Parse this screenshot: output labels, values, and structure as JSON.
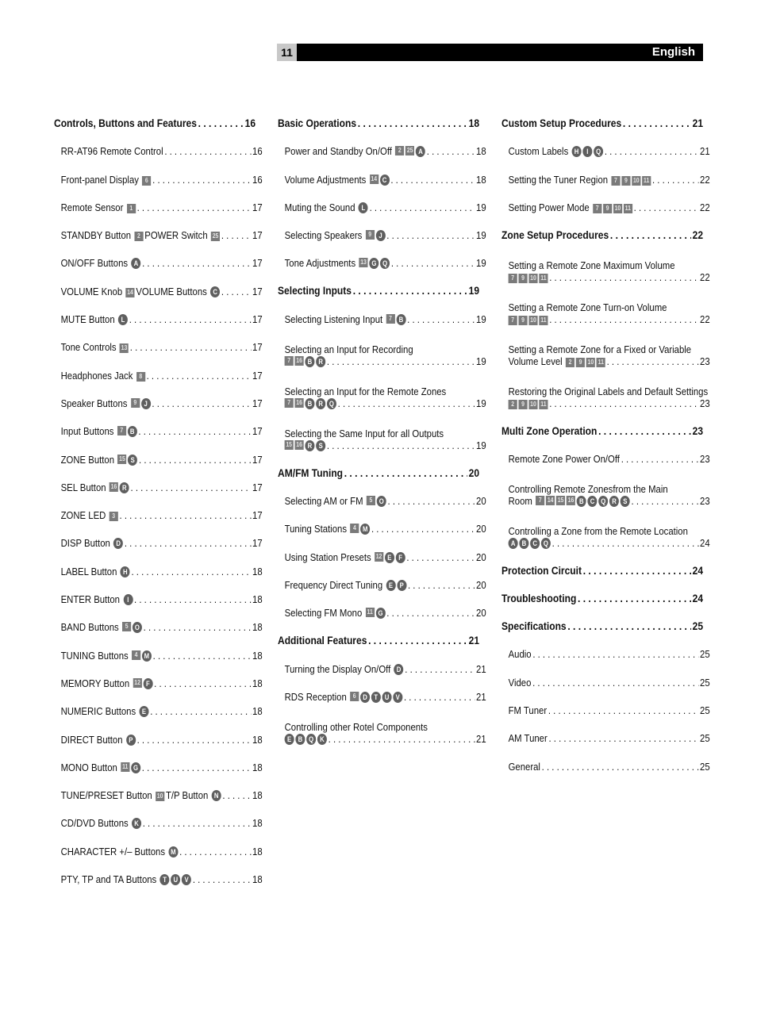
{
  "header": {
    "page_number": "11",
    "language": "English"
  },
  "columns": [
    [
      {
        "type": "section",
        "title": "Controls, Buttons and Features",
        "page": "16",
        "badges": []
      },
      {
        "type": "sub",
        "title": "RR-AT96 Remote Control",
        "page": "16",
        "badges": []
      },
      {
        "type": "sub",
        "title": "Front-panel Display",
        "page": "16",
        "badges": [
          {
            "k": "sq",
            "v": "6"
          }
        ]
      },
      {
        "type": "sub",
        "title": "Remote Sensor",
        "page": "17",
        "badges": [
          {
            "k": "sq",
            "v": "1"
          }
        ]
      },
      {
        "type": "sub",
        "title": "STANDBY Button",
        "page": "17",
        "badges": [
          {
            "k": "sq",
            "v": "2"
          }
        ],
        "title2": "POWER Switch",
        "badges2": [
          {
            "k": "sq",
            "v": "25"
          }
        ]
      },
      {
        "type": "sub",
        "title": "ON/OFF Buttons",
        "page": "17",
        "badges": [
          {
            "k": "ci",
            "v": "A"
          }
        ]
      },
      {
        "type": "sub",
        "title": "VOLUME Knob",
        "page": "17",
        "badges": [
          {
            "k": "sq",
            "v": "14"
          }
        ],
        "title2": "VOLUME Buttons",
        "badges2": [
          {
            "k": "ci",
            "v": "C"
          }
        ]
      },
      {
        "type": "sub",
        "title": "MUTE Button",
        "page": "17",
        "badges": [
          {
            "k": "ci",
            "v": "L"
          }
        ]
      },
      {
        "type": "sub",
        "title": "Tone Controls",
        "page": "17",
        "badges": [
          {
            "k": "sq",
            "v": "13"
          }
        ]
      },
      {
        "type": "sub",
        "title": "Headphones Jack",
        "page": "17",
        "badges": [
          {
            "k": "sq",
            "v": "8"
          }
        ]
      },
      {
        "type": "sub",
        "title": "Speaker Buttons",
        "page": "17",
        "badges": [
          {
            "k": "sq",
            "v": "9"
          },
          {
            "k": "ci",
            "v": "J"
          }
        ]
      },
      {
        "type": "sub",
        "title": "Input Buttons",
        "page": "17",
        "badges": [
          {
            "k": "sq",
            "v": "7"
          },
          {
            "k": "ci",
            "v": "B"
          }
        ]
      },
      {
        "type": "sub",
        "title": "ZONE Button",
        "page": "17",
        "badges": [
          {
            "k": "sq",
            "v": "15"
          },
          {
            "k": "ci",
            "v": "S"
          }
        ]
      },
      {
        "type": "sub",
        "title": "SEL Button",
        "page": "17",
        "badges": [
          {
            "k": "sq",
            "v": "16"
          },
          {
            "k": "ci",
            "v": "R"
          }
        ]
      },
      {
        "type": "sub",
        "title": "ZONE LED",
        "page": "17",
        "badges": [
          {
            "k": "sq",
            "v": "3"
          }
        ]
      },
      {
        "type": "sub",
        "title": "DISP Button",
        "page": "17",
        "badges": [
          {
            "k": "ci",
            "v": "D"
          }
        ]
      },
      {
        "type": "sub",
        "title": "LABEL Button",
        "page": "18",
        "badges": [
          {
            "k": "ci",
            "v": "H"
          }
        ]
      },
      {
        "type": "sub",
        "title": "ENTER Button",
        "page": "18",
        "badges": [
          {
            "k": "ci",
            "v": "I"
          }
        ]
      },
      {
        "type": "sub",
        "title": "BAND Buttons",
        "page": "18",
        "badges": [
          {
            "k": "sq",
            "v": "5"
          },
          {
            "k": "ci",
            "v": "O"
          }
        ]
      },
      {
        "type": "sub",
        "title": "TUNING Buttons",
        "page": "18",
        "badges": [
          {
            "k": "sq",
            "v": "4"
          },
          {
            "k": "ci",
            "v": "M"
          }
        ]
      },
      {
        "type": "sub",
        "title": "MEMORY Button",
        "page": "18",
        "badges": [
          {
            "k": "sq",
            "v": "12"
          },
          {
            "k": "ci",
            "v": "F"
          }
        ]
      },
      {
        "type": "sub",
        "title": "NUMERIC Buttons",
        "page": "18",
        "badges": [
          {
            "k": "ci",
            "v": "E"
          }
        ]
      },
      {
        "type": "sub",
        "title": "DIRECT Button",
        "page": "18",
        "badges": [
          {
            "k": "ci",
            "v": "P"
          }
        ]
      },
      {
        "type": "sub",
        "title": "MONO Button",
        "page": "18",
        "badges": [
          {
            "k": "sq",
            "v": "11"
          },
          {
            "k": "ci",
            "v": "G"
          }
        ]
      },
      {
        "type": "sub",
        "title": "TUNE/PRESET Button",
        "page": "18",
        "badges": [
          {
            "k": "sq",
            "v": "10"
          }
        ],
        "title2": "T/P Button",
        "badges2": [
          {
            "k": "ci",
            "v": "N"
          }
        ]
      },
      {
        "type": "sub",
        "title": "CD/DVD Buttons",
        "page": "18",
        "badges": [
          {
            "k": "ci",
            "v": "K"
          }
        ]
      },
      {
        "type": "sub",
        "title": "CHARACTER +/– Buttons",
        "page": "18",
        "badges": [
          {
            "k": "ci",
            "v": "M"
          }
        ]
      },
      {
        "type": "sub",
        "title": "PTY, TP and TA Buttons",
        "page": "18",
        "badges": [
          {
            "k": "ci",
            "v": "T"
          },
          {
            "k": "ci",
            "v": "U"
          },
          {
            "k": "ci",
            "v": "V"
          }
        ]
      }
    ],
    [
      {
        "type": "section",
        "title": "Basic Operations",
        "page": "18",
        "badges": []
      },
      {
        "type": "sub",
        "title": "Power and Standby On/Off",
        "page": "18",
        "badges": [
          {
            "k": "sq",
            "v": "2"
          },
          {
            "k": "sq",
            "v": "25"
          },
          {
            "k": "ci",
            "v": "A"
          }
        ]
      },
      {
        "type": "sub",
        "title": "Volume Adjustments",
        "page": "18",
        "badges": [
          {
            "k": "sq",
            "v": "14"
          },
          {
            "k": "ci",
            "v": "C"
          }
        ]
      },
      {
        "type": "sub",
        "title": "Muting the Sound",
        "page": "19",
        "badges": [
          {
            "k": "ci",
            "v": "L"
          }
        ]
      },
      {
        "type": "sub",
        "title": "Selecting Speakers",
        "page": "19",
        "badges": [
          {
            "k": "sq",
            "v": "9"
          },
          {
            "k": "ci",
            "v": "J"
          }
        ]
      },
      {
        "type": "sub",
        "title": "Tone Adjustments",
        "page": "19",
        "badges": [
          {
            "k": "sq",
            "v": "13"
          },
          {
            "k": "ci",
            "v": "G"
          },
          {
            "k": "ci",
            "v": "Q"
          }
        ]
      },
      {
        "type": "section",
        "title": "Selecting Inputs",
        "page": "19",
        "badges": []
      },
      {
        "type": "sub",
        "title": "Selecting Listening Input",
        "page": "19",
        "badges": [
          {
            "k": "sq",
            "v": "7"
          },
          {
            "k": "ci",
            "v": "B"
          }
        ]
      },
      {
        "type": "two",
        "title": "Selecting an Input for Recording",
        "page": "19",
        "badges": [
          {
            "k": "sq",
            "v": "7"
          },
          {
            "k": "sq",
            "v": "16"
          },
          {
            "k": "ci",
            "v": "B"
          },
          {
            "k": "ci",
            "v": "R"
          }
        ]
      },
      {
        "type": "two",
        "title": "Selecting an Input for the Remote Zones",
        "page": "19",
        "badges": [
          {
            "k": "sq",
            "v": "7"
          },
          {
            "k": "sq",
            "v": "16"
          },
          {
            "k": "ci",
            "v": "B"
          },
          {
            "k": "ci",
            "v": "R"
          },
          {
            "k": "ci",
            "v": "Q"
          }
        ]
      },
      {
        "type": "two",
        "title": "Selecting the Same Input for all Outputs",
        "page": "19",
        "badges": [
          {
            "k": "sq",
            "v": "15"
          },
          {
            "k": "sq",
            "v": "16"
          },
          {
            "k": "ci",
            "v": "R"
          },
          {
            "k": "ci",
            "v": "S"
          }
        ]
      },
      {
        "type": "section",
        "title": "AM/FM Tuning",
        "page": "20",
        "badges": []
      },
      {
        "type": "sub",
        "title": "Selecting AM or FM",
        "page": "20",
        "badges": [
          {
            "k": "sq",
            "v": "5"
          },
          {
            "k": "ci",
            "v": "O"
          }
        ]
      },
      {
        "type": "sub",
        "title": "Tuning Stations",
        "page": "20",
        "badges": [
          {
            "k": "sq",
            "v": "4"
          },
          {
            "k": "ci",
            "v": "M"
          }
        ]
      },
      {
        "type": "sub",
        "title": "Using Station Presets",
        "page": "20",
        "badges": [
          {
            "k": "sq",
            "v": "12"
          },
          {
            "k": "ci",
            "v": "E"
          },
          {
            "k": "ci",
            "v": "F"
          }
        ]
      },
      {
        "type": "sub",
        "title": "Frequency Direct Tuning",
        "page": "20",
        "badges": [
          {
            "k": "ci",
            "v": "E"
          },
          {
            "k": "ci",
            "v": "P"
          }
        ]
      },
      {
        "type": "sub",
        "title": "Selecting FM Mono",
        "page": "20",
        "badges": [
          {
            "k": "sq",
            "v": "11"
          },
          {
            "k": "ci",
            "v": "G"
          }
        ]
      },
      {
        "type": "section",
        "title": "Additional Features",
        "page": "21",
        "badges": []
      },
      {
        "type": "sub",
        "title": "Turning the Display On/Off",
        "page": "21",
        "badges": [
          {
            "k": "ci",
            "v": "D"
          }
        ]
      },
      {
        "type": "sub",
        "title": "RDS Reception",
        "page": "21",
        "badges": [
          {
            "k": "sq",
            "v": "6"
          },
          {
            "k": "ci",
            "v": "D"
          },
          {
            "k": "ci",
            "v": "T"
          },
          {
            "k": "ci",
            "v": "U"
          },
          {
            "k": "ci",
            "v": "V"
          }
        ]
      },
      {
        "type": "two",
        "title": "Controlling other Rotel Components",
        "page": "21",
        "badges": [
          {
            "k": "ci",
            "v": "E"
          },
          {
            "k": "ci",
            "v": "B"
          },
          {
            "k": "ci",
            "v": "Q"
          },
          {
            "k": "ci",
            "v": "K"
          }
        ]
      }
    ],
    [
      {
        "type": "section",
        "title": "Custom Setup Procedures",
        "page": "21",
        "badges": []
      },
      {
        "type": "sub",
        "title": "Custom Labels",
        "page": "21",
        "badges": [
          {
            "k": "ci",
            "v": "H"
          },
          {
            "k": "ci",
            "v": "I"
          },
          {
            "k": "ci",
            "v": "Q"
          }
        ]
      },
      {
        "type": "sub",
        "title": "Setting the Tuner Region",
        "page": "22",
        "badges": [
          {
            "k": "sq",
            "v": "7"
          },
          {
            "k": "sq",
            "v": "9"
          },
          {
            "k": "sq",
            "v": "10"
          },
          {
            "k": "sq",
            "v": "11"
          }
        ]
      },
      {
        "type": "sub",
        "title": "Setting Power Mode",
        "page": "22",
        "badges": [
          {
            "k": "sq",
            "v": "7"
          },
          {
            "k": "sq",
            "v": "9"
          },
          {
            "k": "sq",
            "v": "10"
          },
          {
            "k": "sq",
            "v": "11"
          }
        ]
      },
      {
        "type": "section",
        "title": "Zone Setup Procedures",
        "page": "22",
        "badges": []
      },
      {
        "type": "two",
        "title": "Setting a Remote Zone Maximum Volume",
        "page": "22",
        "badges": [
          {
            "k": "sq",
            "v": "7"
          },
          {
            "k": "sq",
            "v": "9"
          },
          {
            "k": "sq",
            "v": "10"
          },
          {
            "k": "sq",
            "v": "11"
          }
        ]
      },
      {
        "type": "two",
        "title": "Setting a Remote Zone Turn-on Volume",
        "page": "22",
        "badges": [
          {
            "k": "sq",
            "v": "7"
          },
          {
            "k": "sq",
            "v": "9"
          },
          {
            "k": "sq",
            "v": "10"
          },
          {
            "k": "sq",
            "v": "11"
          }
        ]
      },
      {
        "type": "two",
        "title": "Setting a Remote Zone for a Fixed or Variable",
        "line2": "Volume Level",
        "page": "23",
        "badges": [
          {
            "k": "sq",
            "v": "2"
          },
          {
            "k": "sq",
            "v": "9"
          },
          {
            "k": "sq",
            "v": "10"
          },
          {
            "k": "sq",
            "v": "11"
          }
        ]
      },
      {
        "type": "two",
        "title": "Restoring the Original Labels and Default Settings",
        "page": "23",
        "badges": [
          {
            "k": "sq",
            "v": "2"
          },
          {
            "k": "sq",
            "v": "9"
          },
          {
            "k": "sq",
            "v": "10"
          },
          {
            "k": "sq",
            "v": "11"
          }
        ]
      },
      {
        "type": "section",
        "title": "Multi Zone Operation",
        "page": "23",
        "badges": []
      },
      {
        "type": "sub",
        "title": "Remote Zone Power On/Off",
        "page": "23",
        "badges": []
      },
      {
        "type": "two",
        "title": "Controlling Remote Zonesfrom the Main",
        "line2": "Room",
        "page": "23",
        "badges": [
          {
            "k": "sq",
            "v": "7"
          },
          {
            "k": "sq",
            "v": "14"
          },
          {
            "k": "sq",
            "v": "15"
          },
          {
            "k": "sq",
            "v": "16"
          },
          {
            "k": "ci",
            "v": "B"
          },
          {
            "k": "ci",
            "v": "C"
          },
          {
            "k": "ci",
            "v": "Q"
          },
          {
            "k": "ci",
            "v": "R"
          },
          {
            "k": "ci",
            "v": "S"
          }
        ]
      },
      {
        "type": "two",
        "title": "Controlling a Zone from the Remote Location",
        "page": "24",
        "badges": [
          {
            "k": "ci",
            "v": "A"
          },
          {
            "k": "ci",
            "v": "B"
          },
          {
            "k": "ci",
            "v": "C"
          },
          {
            "k": "ci",
            "v": "Q"
          }
        ]
      },
      {
        "type": "section",
        "title": "Protection Circuit",
        "page": "24",
        "badges": []
      },
      {
        "type": "section",
        "title": "Troubleshooting",
        "page": "24",
        "badges": []
      },
      {
        "type": "section",
        "title": "Specifications",
        "page": "25",
        "badges": []
      },
      {
        "type": "sub",
        "title": "Audio",
        "page": "25",
        "badges": []
      },
      {
        "type": "sub",
        "title": "Video",
        "page": "25",
        "badges": []
      },
      {
        "type": "sub",
        "title": "FM Tuner",
        "page": "25",
        "badges": []
      },
      {
        "type": "sub",
        "title": "AM Tuner",
        "page": "25",
        "badges": []
      },
      {
        "type": "sub",
        "title": "General",
        "page": "25",
        "badges": []
      }
    ]
  ]
}
